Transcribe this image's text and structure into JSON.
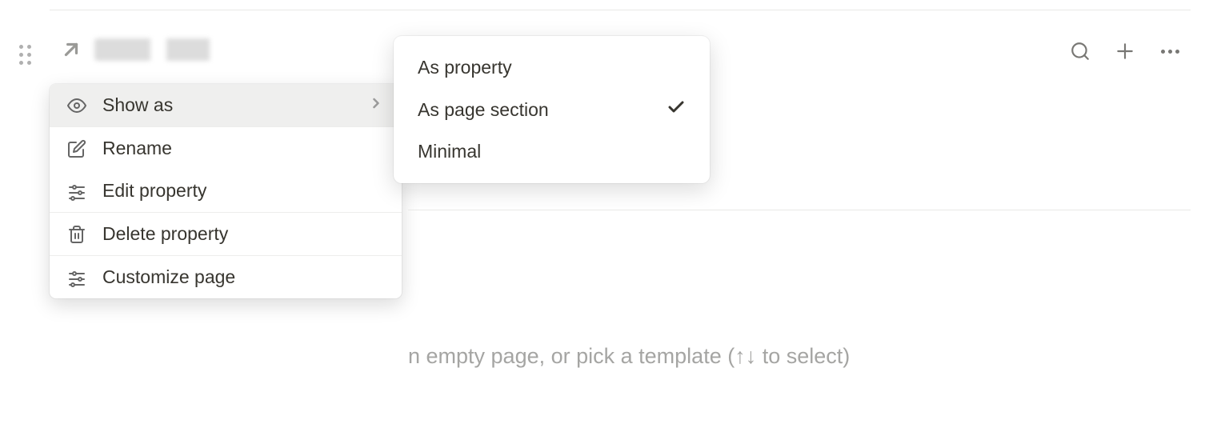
{
  "contextMenu": {
    "items": [
      {
        "label": "Show as",
        "icon": "eye",
        "hasSubmenu": true,
        "highlighted": true
      },
      {
        "label": "Rename",
        "icon": "rename"
      },
      {
        "label": "Edit property",
        "icon": "sliders"
      },
      {
        "label": "Delete property",
        "icon": "trash"
      },
      {
        "label": "Customize page",
        "icon": "sliders"
      }
    ]
  },
  "submenu": {
    "items": [
      {
        "label": "As property",
        "selected": false
      },
      {
        "label": "As page section",
        "selected": true
      },
      {
        "label": "Minimal",
        "selected": false
      }
    ]
  },
  "placeholder": "n empty page, or pick a template (↑↓ to select)"
}
